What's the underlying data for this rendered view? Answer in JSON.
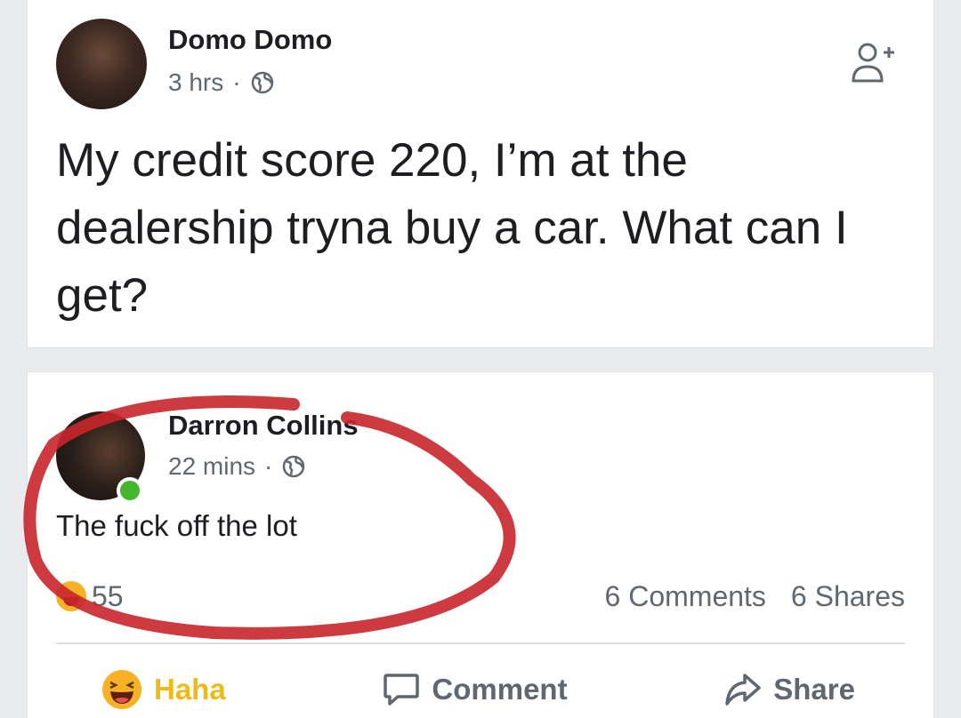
{
  "post": {
    "author": "Domo Domo",
    "time": "3 hrs",
    "separator": "·",
    "text": "My credit score 220, I’m at the dealership tryna buy a car. What can I get?"
  },
  "comment_post": {
    "author": "Darron Collins",
    "time": "22 mins",
    "separator": "·",
    "text": "The fuck off the lot",
    "reaction_count": "55",
    "comments_count": "6 Comments",
    "shares_count": "6 Shares"
  },
  "actions": {
    "haha": "Haha",
    "comment": "Comment",
    "share": "Share"
  },
  "colors": {
    "haha_active": "#f0ba15",
    "online": "#42b72a",
    "annotation_circle": "#c8262b"
  },
  "icons": [
    "globe-icon",
    "add-friend-icon",
    "haha-icon",
    "comment-icon",
    "share-icon"
  ]
}
